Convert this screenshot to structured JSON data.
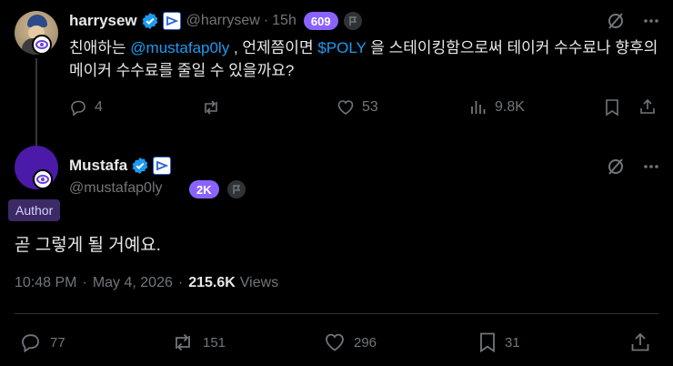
{
  "reply": {
    "name": "harrysew",
    "handle": "@harrysew",
    "sep": "·",
    "time": "15h",
    "badge_count": "609",
    "text_part1": "친애하는 ",
    "mention": "@mustafap0ly",
    "text_part2": " , 언제쯤이면 ",
    "cashtag": "$POLY",
    "text_part3": " 을 스테이킹함으로써 테이커 수수료나 향후의 메이커 수수료를 줄일 수 있을까요?",
    "actions": {
      "replies": "4",
      "reposts": "",
      "likes": "53",
      "views": "9.8K"
    }
  },
  "main": {
    "name": "Mustafa",
    "handle": "@mustafap0ly",
    "badge": "2K",
    "author_label": "Author",
    "text": "곧 그렇게 될 거예요.",
    "time": "10:48 PM",
    "sep": "·",
    "date": "May 4, 2026",
    "sep2": "·",
    "views_count": "215.6K",
    "views_label": "Views",
    "actions": {
      "replies": "77",
      "reposts": "151",
      "likes": "296",
      "bookmarks": "31"
    }
  },
  "colors": {
    "accent": "#1d9bf0",
    "badge_purple": "#8a63ff",
    "muted": "#71767b"
  }
}
